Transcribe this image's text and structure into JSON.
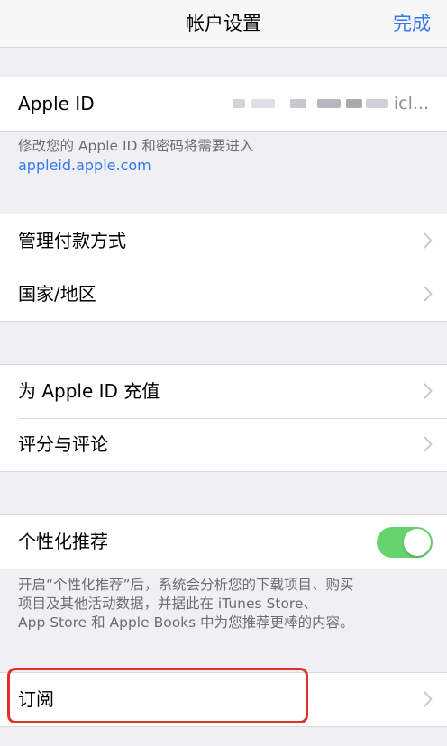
{
  "nav": {
    "title": "帐户设置",
    "done_label": "完成"
  },
  "apple_id": {
    "label": "Apple ID",
    "value_visible_suffix": "icl...",
    "note": "修改您的 Apple ID 和密码将需要进入",
    "link": "appleid.apple.com"
  },
  "payment_group": {
    "items": [
      {
        "label": "管理付款方式"
      },
      {
        "label": "国家/地区"
      }
    ]
  },
  "apple_id_group": {
    "items": [
      {
        "label": "为 Apple ID 充值"
      },
      {
        "label": "评分与评论"
      }
    ]
  },
  "personalization": {
    "label": "个性化推荐",
    "toggle_on": true,
    "note_lines": [
      "开启“个性化推荐”后，系统会分析您的下载项目、购买",
      "项目及其他活动数据，并据此在 iTunes Store、",
      "App Store 和 Apple Books 中为您推荐更棒的内容。"
    ]
  },
  "subscriptions": {
    "label": "订阅"
  },
  "colors": {
    "accent": "#3478f6",
    "toggle_on": "#65d46e",
    "highlight": "#e0322a",
    "background": "#efeff4"
  }
}
